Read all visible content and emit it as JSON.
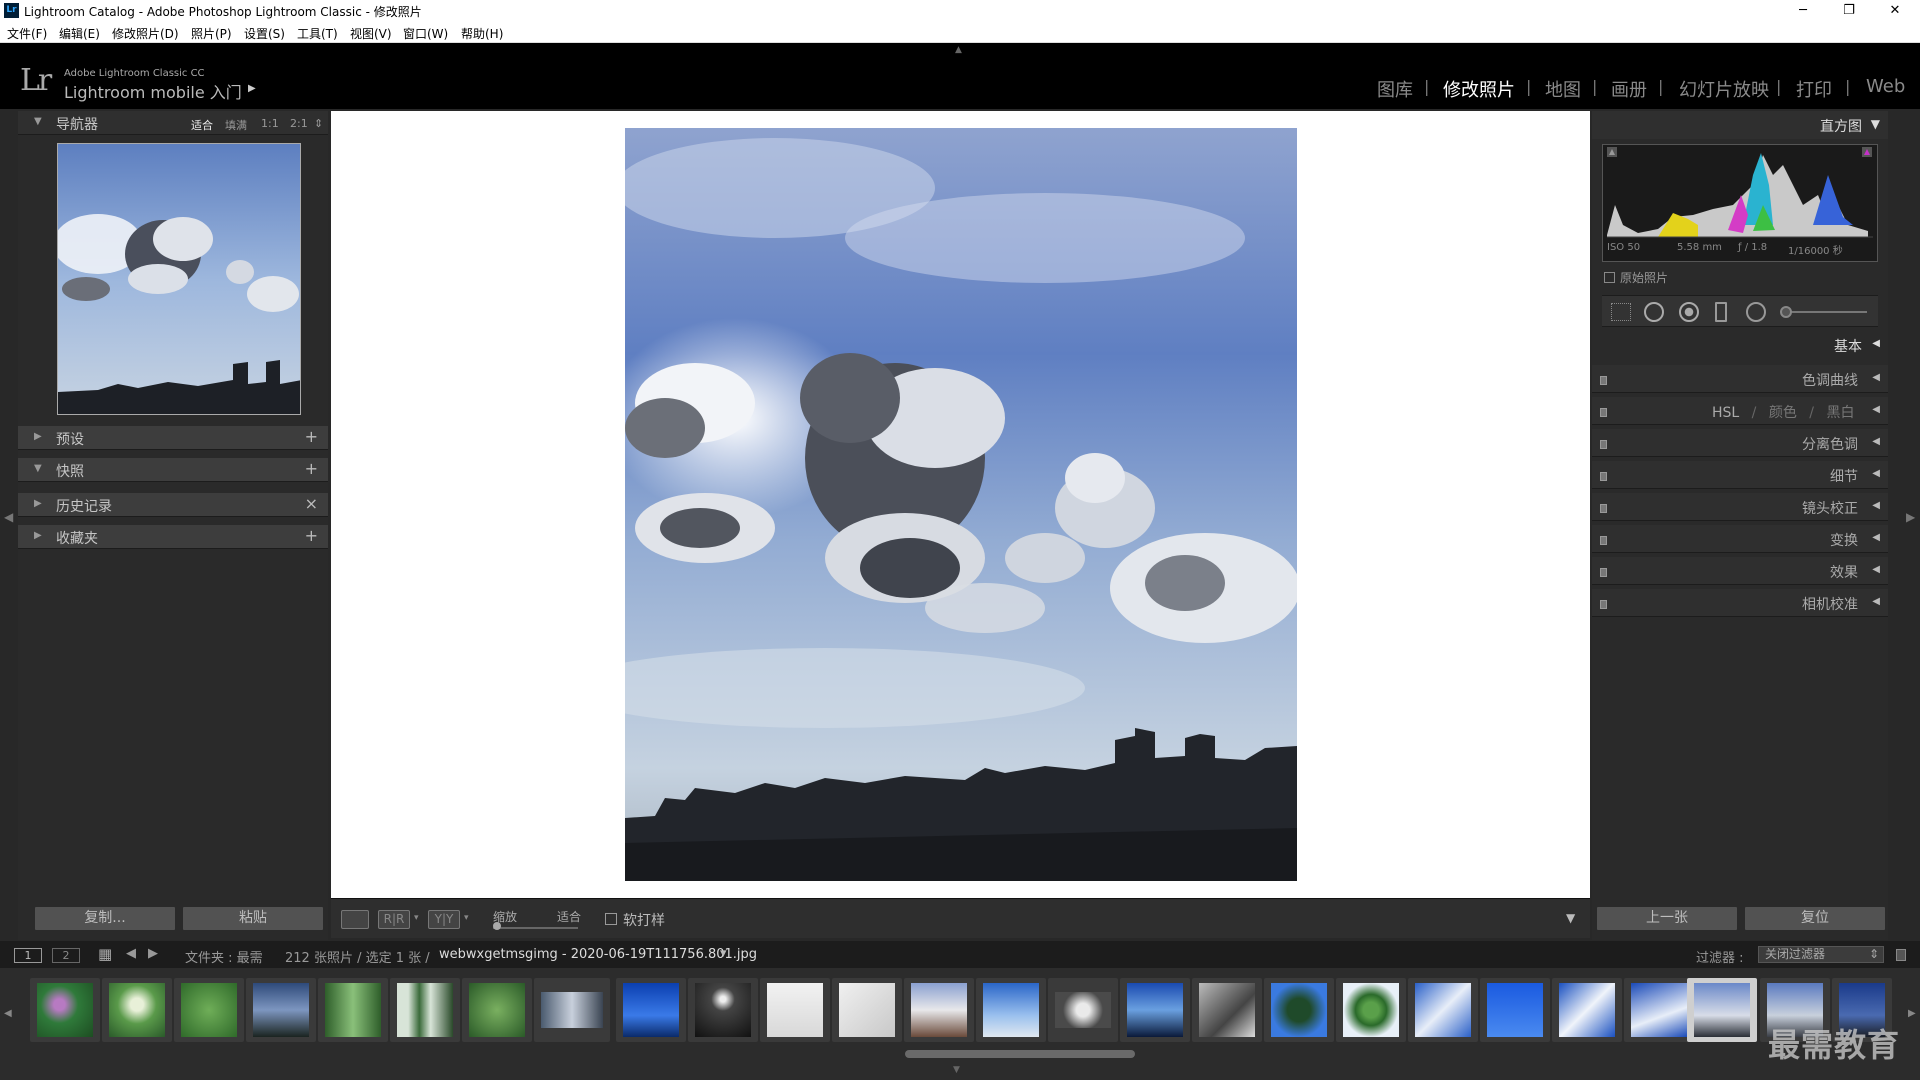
{
  "window": {
    "title": "Lightroom Catalog - Adobe Photoshop Lightroom Classic - 修改照片",
    "app_icon": "Lr",
    "min": "─",
    "max": "❐",
    "close": "✕"
  },
  "menu": [
    "文件(F)",
    "编辑(E)",
    "修改照片(D)",
    "照片(P)",
    "设置(S)",
    "工具(T)",
    "视图(V)",
    "窗口(W)",
    "帮助(H)"
  ],
  "brand": {
    "logo": "Lr",
    "line1": "Adobe Lightroom Classic CC",
    "line2": "Lightroom mobile 入门",
    "arrow": "▶"
  },
  "modules": [
    {
      "label": "图库",
      "active": false
    },
    {
      "label": "修改照片",
      "active": true
    },
    {
      "label": "地图",
      "active": false
    },
    {
      "label": "画册",
      "active": false
    },
    {
      "label": "幻灯片放映",
      "active": false
    },
    {
      "label": "打印",
      "active": false
    },
    {
      "label": "Web",
      "active": false
    }
  ],
  "module_sep": "|",
  "navigator": {
    "title": "导航器",
    "tri": "▼",
    "options": [
      "适合",
      "填满",
      "1:1",
      "2:1",
      "⇕"
    ]
  },
  "left_sections": [
    {
      "label": "预设",
      "tri": "▶",
      "action": "+"
    },
    {
      "label": "快照",
      "tri": "▼",
      "action": "+"
    },
    {
      "label": "历史记录",
      "tri": "▶",
      "action": "×"
    },
    {
      "label": "收藏夹",
      "tri": "▶",
      "action": "+"
    }
  ],
  "left_buttons": {
    "copy": "复制...",
    "paste": "粘贴"
  },
  "toolbar": {
    "rr": "R|R",
    "yy": "Y|Y",
    "zoom_label": "缩放",
    "zoom_value": "适合",
    "softproof": "软打样",
    "menu_arrow": "▼"
  },
  "histogram": {
    "title": "直方图",
    "tri": "▼",
    "iso": "ISO 50",
    "focal": "5.58 mm",
    "aperture": "ƒ / 1.8",
    "shutter": "1/16000 秒",
    "original": "原始照片"
  },
  "right_sections": [
    "色调曲线",
    "分离色调",
    "细节",
    "镜头校正",
    "变换",
    "效果",
    "相机校准"
  ],
  "basic": {
    "label": "基本",
    "arrow": "◀"
  },
  "hsl": {
    "hsl": "HSL",
    "sep": "/",
    "color": "颜色",
    "bw": "黑白"
  },
  "right_arrow": "◀",
  "right_buttons": {
    "prev": "上一张",
    "reset": "复位"
  },
  "filmhead": {
    "view1": "1",
    "view2": "2",
    "grid": "▦",
    "back": "◀",
    "fwd": "▶",
    "folder": "文件夹 : 最需",
    "count": "212 张照片 / 选定 1 张 /",
    "filename": "webwxgetmsgimg - 2020-06-19T111756.801.jpg",
    "dd": "▾",
    "filter_label": "过滤器 :",
    "filter_value": "关闭过滤器",
    "filter_arrow": "⇕"
  },
  "watermark": "最需教育",
  "colors": {
    "accent": "#ffffff",
    "panel": "#2a2a2a",
    "header": "#000000"
  }
}
